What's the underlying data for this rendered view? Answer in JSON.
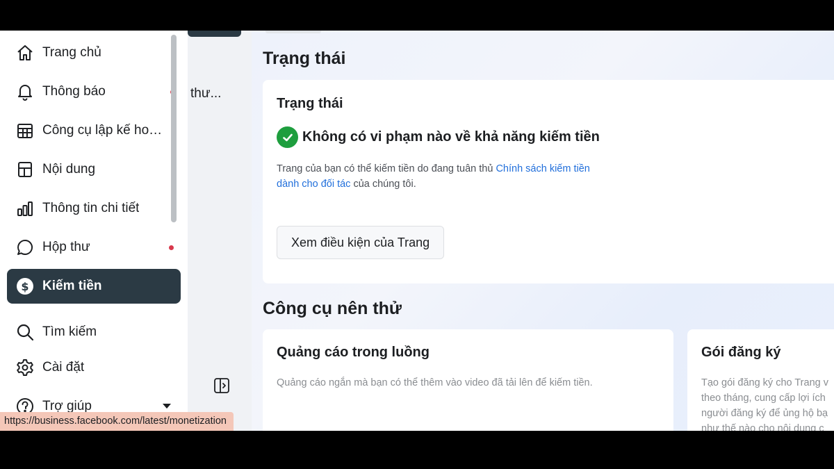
{
  "sidebar": {
    "items": [
      {
        "label": "Trang chủ",
        "icon": "home-icon"
      },
      {
        "label": "Thông báo",
        "icon": "bell-icon"
      },
      {
        "label": "Công cụ lập kế hoạch",
        "icon": "calendar-grid-icon"
      },
      {
        "label": "Nội dung",
        "icon": "content-icon"
      },
      {
        "label": "Thông tin chi tiết",
        "icon": "bar-chart-icon"
      },
      {
        "label": "Hộp thư",
        "icon": "chat-bubble-icon"
      },
      {
        "label": "Kiếm tiền",
        "icon": "dollar-icon"
      },
      {
        "label": "Tìm kiếm",
        "icon": "search-icon"
      },
      {
        "label": "Cài đặt",
        "icon": "gear-icon"
      },
      {
        "label": "Trợ giúp",
        "icon": "help-icon"
      }
    ],
    "active_item": "Kiếm tiền"
  },
  "second_col": {
    "truncated_text": "thư..."
  },
  "main": {
    "status_section": {
      "title": "Trạng thái",
      "card": {
        "title": "Trạng thái",
        "status_text": "Không có vi phạm nào về khả năng kiếm tiền",
        "desc_before": "Trang của bạn có thể kiếm tiền do đang tuân thủ ",
        "desc_link": "Chính sách kiếm tiền dành cho đối tác",
        "desc_after": " của chúng tôi.",
        "button_label": "Xem điều kiện của Trang"
      }
    },
    "tools_section": {
      "title": "Công cụ nên thử",
      "cards": [
        {
          "title": "Quảng cáo trong luồng",
          "desc": "Quảng cáo ngắn mà bạn có thể thêm vào video đã tải lên để kiếm tiền."
        },
        {
          "title": "Gói đăng ký",
          "desc_lines": [
            "Tạo gói đăng ký cho Trang v",
            "theo tháng, cung cấp lợi ích",
            "người đăng ký để ủng hộ bạ",
            "như thế nào cho nội dung c"
          ]
        }
      ]
    }
  },
  "status_bar": {
    "url": "https://business.facebook.com/latest/monetization"
  },
  "colors": {
    "active_bg": "#2b3a44",
    "link": "#216fdb",
    "success": "#1e9e3e",
    "notification_dot": "#d8394c"
  }
}
